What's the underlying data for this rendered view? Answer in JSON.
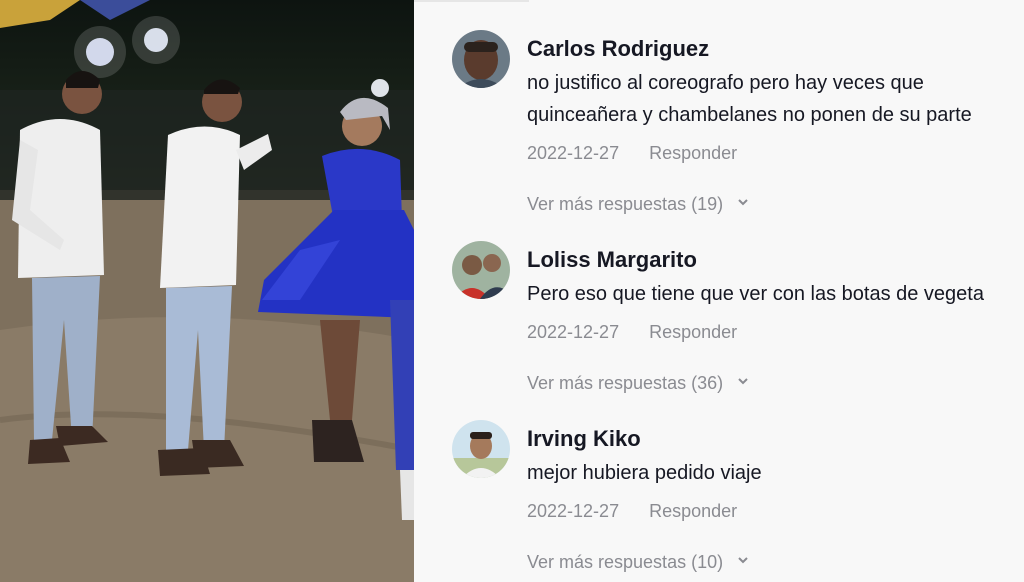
{
  "comments": [
    {
      "author": "Carlos Rodriguez",
      "lines": [
        "no justifico al coreografo pero hay veces que",
        "quinceañera y chambelanes no ponen de su parte"
      ],
      "date": "2022-12-27",
      "reply_label": "Responder",
      "more_replies": "Ver más respuestas (19)"
    },
    {
      "author": "Loliss Margarito",
      "lines": [
        "Pero eso que tiene que ver con las botas de vegeta"
      ],
      "date": "2022-12-27",
      "reply_label": "Responder",
      "more_replies": "Ver más respuestas (36)"
    },
    {
      "author": "Irving Kiko",
      "lines": [
        "mejor hubiera pedido viaje"
      ],
      "date": "2022-12-27",
      "reply_label": "Responder",
      "more_replies": "Ver más respuestas (10)"
    }
  ],
  "icons": {
    "expand": "chevron-down-icon",
    "avatar": "avatar"
  },
  "colors": {
    "text": "#161823",
    "muted": "#8a8b91",
    "background": "#f8f8f8",
    "dress": "#2a38c8"
  }
}
